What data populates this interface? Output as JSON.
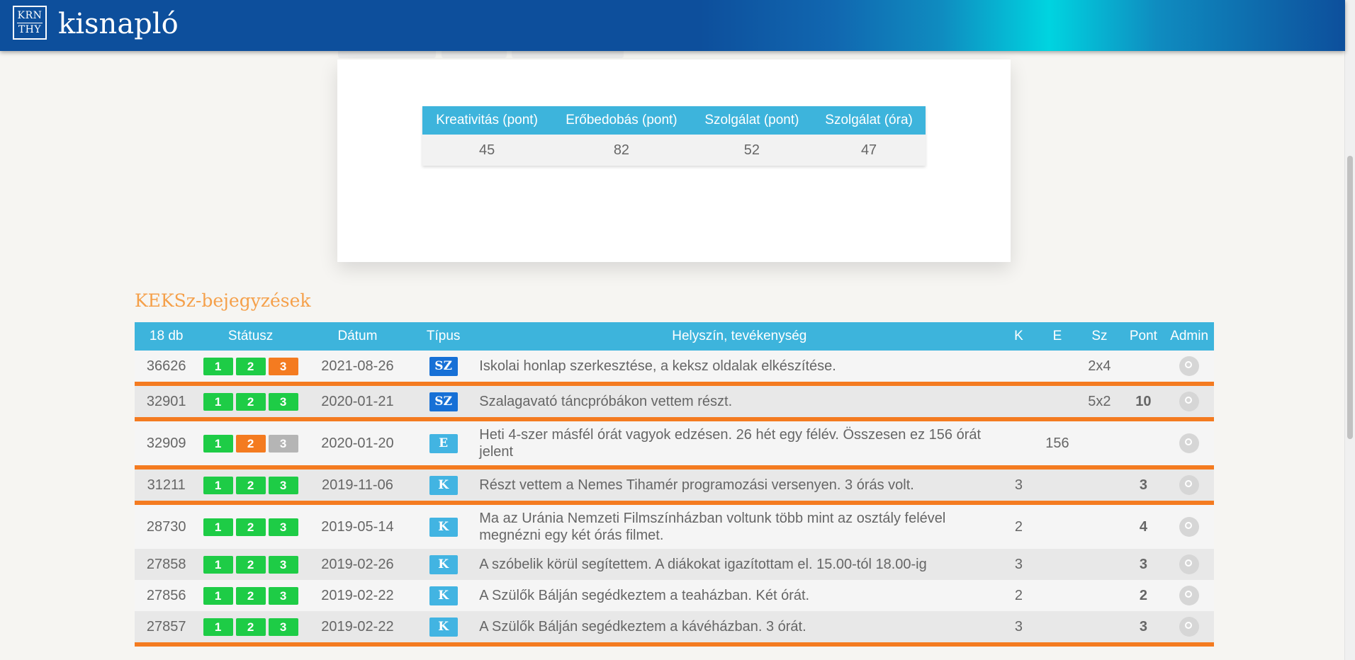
{
  "header": {
    "logo_line1": "KRN",
    "logo_line2": "THY",
    "app_title": "kisnapló"
  },
  "stats": {
    "headers": [
      "Kreativitás (pont)",
      "Erőbedobás (pont)",
      "Szolgálat (pont)",
      "Szolgálat (óra)"
    ],
    "values": [
      "45",
      "82",
      "52",
      "47"
    ]
  },
  "entries": {
    "section_title": "KEKSz-bejegyzések",
    "headers": {
      "count": "18 db",
      "status": "Státusz",
      "date": "Dátum",
      "type": "Típus",
      "activity": "Helyszín, tevékenység",
      "k": "K",
      "e": "E",
      "sz": "Sz",
      "pont": "Pont",
      "admin": "Admin"
    },
    "rows": [
      {
        "id": "36626",
        "status": [
          {
            "label": "1",
            "color": "green"
          },
          {
            "label": "2",
            "color": "green"
          },
          {
            "label": "3",
            "color": "orange"
          }
        ],
        "date": "2021-08-26",
        "type": "SZ",
        "type_color": "#1770d6",
        "activity": "Iskolai honlap szerkesztése, a keksz oldalak elkészítése.",
        "k": "",
        "e": "",
        "sz": "2x4",
        "pont": ""
      },
      {
        "id": "32901",
        "status": [
          {
            "label": "1",
            "color": "green"
          },
          {
            "label": "2",
            "color": "green"
          },
          {
            "label": "3",
            "color": "green"
          }
        ],
        "date": "2020-01-21",
        "type": "SZ",
        "type_color": "#1770d6",
        "activity": "Szalagavató táncpróbákon vettem részt.",
        "k": "",
        "e": "",
        "sz": "5x2",
        "pont": "10"
      },
      {
        "id": "32909",
        "status": [
          {
            "label": "1",
            "color": "green"
          },
          {
            "label": "2",
            "color": "orange"
          },
          {
            "label": "3",
            "color": "grey"
          }
        ],
        "date": "2020-01-20",
        "type": "E",
        "type_color": "#42b4e2",
        "activity": "Heti 4-szer másfél órát vagyok edzésen. 26 hét egy félév. Összesen ez 156 órát jelent",
        "k": "",
        "e": "156",
        "sz": "",
        "pont": ""
      },
      {
        "id": "31211",
        "status": [
          {
            "label": "1",
            "color": "green"
          },
          {
            "label": "2",
            "color": "green"
          },
          {
            "label": "3",
            "color": "green"
          }
        ],
        "date": "2019-11-06",
        "type": "K",
        "type_color": "#42b4e2",
        "activity": "Részt vettem a Nemes Tihamér programozási versenyen. 3 órás volt.",
        "k": "3",
        "e": "",
        "sz": "",
        "pont": "3"
      },
      {
        "id": "28730",
        "status": [
          {
            "label": "1",
            "color": "green"
          },
          {
            "label": "2",
            "color": "green"
          },
          {
            "label": "3",
            "color": "green"
          }
        ],
        "date": "2019-05-14",
        "type": "K",
        "type_color": "#42b4e2",
        "activity": "Ma az Uránia Nemzeti Filmszínházban voltunk több mint az osztály felével megnézni egy két órás filmet.",
        "k": "2",
        "e": "",
        "sz": "",
        "pont": "4"
      },
      {
        "id": "27858",
        "status": [
          {
            "label": "1",
            "color": "green"
          },
          {
            "label": "2",
            "color": "green"
          },
          {
            "label": "3",
            "color": "green"
          }
        ],
        "date": "2019-02-26",
        "type": "K",
        "type_color": "#42b4e2",
        "activity": "A szóbelik körül segítettem. A diákokat igazítottam el. 15.00-tól 18.00-ig",
        "k": "3",
        "e": "",
        "sz": "",
        "pont": "3"
      },
      {
        "id": "27856",
        "status": [
          {
            "label": "1",
            "color": "green"
          },
          {
            "label": "2",
            "color": "green"
          },
          {
            "label": "3",
            "color": "green"
          }
        ],
        "date": "2019-02-22",
        "type": "K",
        "type_color": "#42b4e2",
        "activity": "A Szülők Bálján segédkeztem a teaházban. Két órát.",
        "k": "2",
        "e": "",
        "sz": "",
        "pont": "2"
      },
      {
        "id": "27857",
        "status": [
          {
            "label": "1",
            "color": "green"
          },
          {
            "label": "2",
            "color": "green"
          },
          {
            "label": "3",
            "color": "green"
          }
        ],
        "date": "2019-02-22",
        "type": "K",
        "type_color": "#42b4e2",
        "activity": "A Szülők Bálján segédkeztem a kávéházban. 3 órát.",
        "k": "3",
        "e": "",
        "sz": "",
        "pont": "3"
      }
    ]
  }
}
